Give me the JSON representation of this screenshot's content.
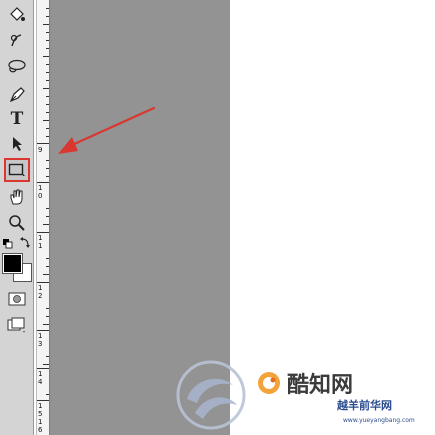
{
  "toolbar": {
    "tools": [
      {
        "name": "paint-bucket-icon",
        "glyph": ""
      },
      {
        "name": "burn-tool-icon",
        "glyph": ""
      },
      {
        "name": "lasso-path-icon",
        "glyph": ""
      },
      {
        "name": "pen-tool-icon",
        "glyph": ""
      },
      {
        "name": "type-tool-icon",
        "glyph": "T"
      },
      {
        "name": "path-selection-icon",
        "glyph": ""
      },
      {
        "name": "rectangle-tool-icon",
        "glyph": "",
        "selected": true
      },
      {
        "name": "hand-tool-icon",
        "glyph": ""
      },
      {
        "name": "zoom-tool-icon",
        "glyph": ""
      }
    ],
    "colors": {
      "foreground": "#000000",
      "background": "#ffffff"
    }
  },
  "ruler": {
    "labels": [
      "9",
      "1",
      "0",
      "1",
      "1",
      "1",
      "2",
      "1",
      "3",
      "1",
      "4",
      "1",
      "5",
      "1",
      "6"
    ]
  },
  "highlight_color": "#d9372f",
  "watermark": {
    "main_text": "酷知网",
    "secondary_text": "越羊前华网",
    "url": "www.yueyangbang.com"
  }
}
